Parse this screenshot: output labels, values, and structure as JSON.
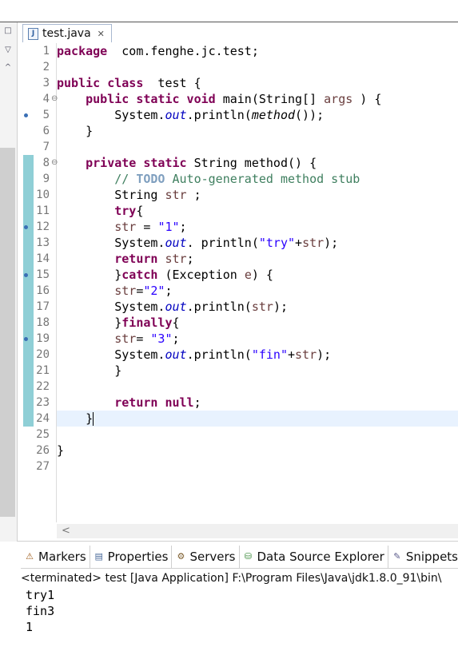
{
  "editor": {
    "tab_label": "test.java",
    "tab_icon": "J",
    "close_glyph": "✕",
    "line_numbers": [
      "1",
      "2",
      "3",
      "4",
      "5",
      "6",
      "7",
      "8",
      "9",
      "10",
      "11",
      "12",
      "13",
      "14",
      "15",
      "16",
      "17",
      "18",
      "19",
      "20",
      "21",
      "22",
      "23",
      "24",
      "25",
      "26",
      "27"
    ],
    "lines": [
      [
        [
          "kw",
          "package"
        ],
        [
          "",
          "  com.fenghe.jc.test;"
        ]
      ],
      [],
      [
        [
          "kw",
          "public class"
        ],
        [
          "",
          "  test {"
        ]
      ],
      [
        [
          "",
          "    "
        ],
        [
          "kw",
          "public static void"
        ],
        [
          "",
          " main(String[] "
        ],
        [
          "var",
          "args"
        ],
        [
          "",
          " ) {"
        ]
      ],
      [
        [
          "",
          "        System."
        ],
        [
          "fld",
          "out"
        ],
        [
          "",
          ".println("
        ],
        [
          "ital",
          "method"
        ],
        [
          "",
          "());"
        ]
      ],
      [
        [
          "",
          "    }"
        ]
      ],
      [],
      [
        [
          "",
          "    "
        ],
        [
          "kw",
          "private static"
        ],
        [
          "",
          " String method() {"
        ]
      ],
      [
        [
          "",
          "        "
        ],
        [
          "cmt",
          "// "
        ],
        [
          "todo",
          "TODO"
        ],
        [
          "cmt",
          " Auto-generated method stub"
        ]
      ],
      [
        [
          "",
          "        String "
        ],
        [
          "var",
          "str"
        ],
        [
          "",
          " ;"
        ]
      ],
      [
        [
          "",
          "        "
        ],
        [
          "kw",
          "try"
        ],
        [
          "",
          "{"
        ]
      ],
      [
        [
          "",
          "        "
        ],
        [
          "var",
          "str"
        ],
        [
          "",
          " = "
        ],
        [
          "str",
          "\"1\""
        ],
        [
          "",
          ";"
        ]
      ],
      [
        [
          "",
          "        System."
        ],
        [
          "fld",
          "out"
        ],
        [
          "",
          ". println("
        ],
        [
          "str",
          "\"try\""
        ],
        [
          "",
          "+"
        ],
        [
          "var",
          "str"
        ],
        [
          "",
          ");"
        ]
      ],
      [
        [
          "",
          "        "
        ],
        [
          "kw",
          "return"
        ],
        [
          "",
          " "
        ],
        [
          "var",
          "str"
        ],
        [
          "",
          ";"
        ]
      ],
      [
        [
          "",
          "        }"
        ],
        [
          "kw",
          "catch"
        ],
        [
          "",
          " (Exception "
        ],
        [
          "var",
          "e"
        ],
        [
          "",
          ") {"
        ]
      ],
      [
        [
          "",
          "        "
        ],
        [
          "var",
          "str"
        ],
        [
          "",
          "="
        ],
        [
          "str",
          "\"2\""
        ],
        [
          "",
          ";"
        ]
      ],
      [
        [
          "",
          "        System."
        ],
        [
          "fld",
          "out"
        ],
        [
          "",
          ".println("
        ],
        [
          "var",
          "str"
        ],
        [
          "",
          ");"
        ]
      ],
      [
        [
          "",
          "        }"
        ],
        [
          "kw",
          "finally"
        ],
        [
          "",
          "{"
        ]
      ],
      [
        [
          "",
          "        "
        ],
        [
          "var",
          "str"
        ],
        [
          "",
          "= "
        ],
        [
          "str",
          "\"3\""
        ],
        [
          "",
          ";"
        ]
      ],
      [
        [
          "",
          "        System."
        ],
        [
          "fld",
          "out"
        ],
        [
          "",
          ".println("
        ],
        [
          "str",
          "\"fin\""
        ],
        [
          "",
          "+"
        ],
        [
          "var",
          "str"
        ],
        [
          "",
          ");"
        ]
      ],
      [
        [
          "",
          "        }"
        ]
      ],
      [],
      [
        [
          "",
          "        "
        ],
        [
          "kw",
          "return null"
        ],
        [
          "",
          ";"
        ]
      ],
      [
        [
          "",
          "    }"
        ]
      ],
      [],
      [
        [
          "",
          "}"
        ]
      ],
      []
    ]
  },
  "views": {
    "tabs": [
      {
        "label": "Markers",
        "icon": "markers-icon"
      },
      {
        "label": "Properties",
        "icon": "properties-icon"
      },
      {
        "label": "Servers",
        "icon": "servers-icon"
      },
      {
        "label": "Data Source Explorer",
        "icon": "data-source-icon"
      },
      {
        "label": "Snippets",
        "icon": "snippets-icon"
      }
    ]
  },
  "console": {
    "header": "<terminated> test [Java Application] F:\\Program Files\\Java\\jdk1.8.0_91\\bin\\",
    "output": [
      "try1",
      "fin3",
      "1"
    ]
  },
  "colors": {
    "keyword": "#7f0055",
    "string": "#2a00ff",
    "comment": "#3f7f5f",
    "field": "#0000c0",
    "current_line": "#e8f2fe"
  }
}
